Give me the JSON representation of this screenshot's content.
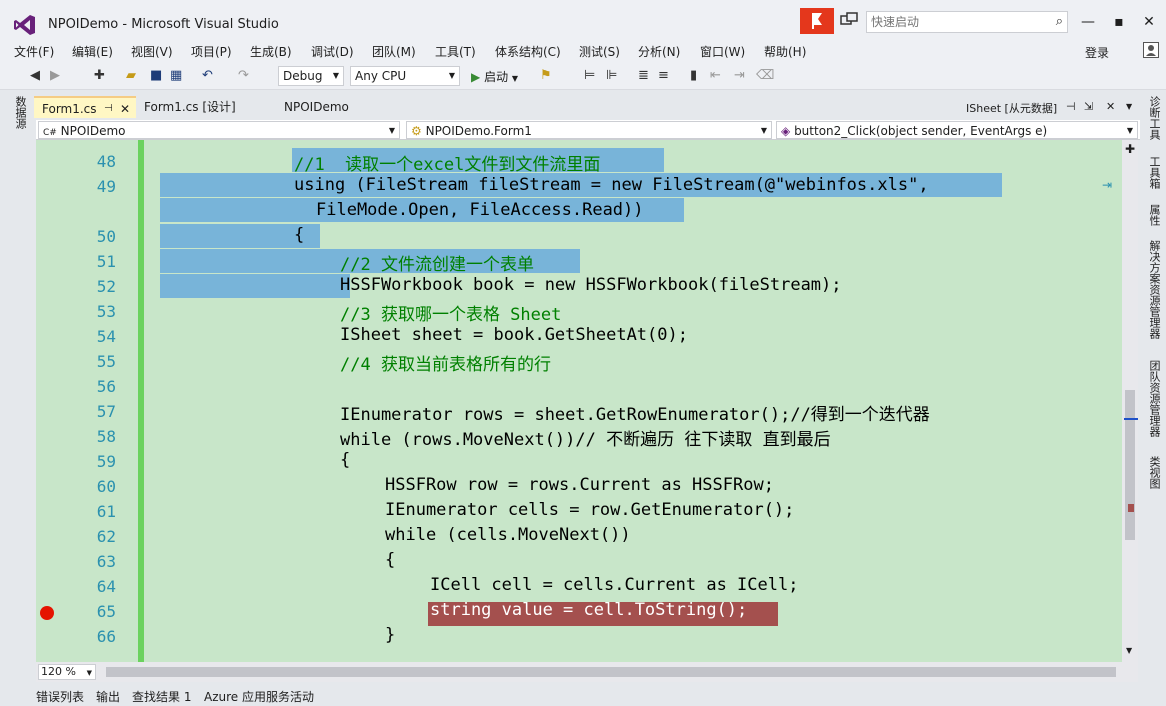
{
  "window": {
    "title": "NPOIDemo - Microsoft Visual Studio",
    "quick_launch_placeholder": "快速启动",
    "login": "登录"
  },
  "menu": [
    "文件(F)",
    "编辑(E)",
    "视图(V)",
    "项目(P)",
    "生成(B)",
    "调试(D)",
    "团队(M)",
    "工具(T)",
    "体系结构(C)",
    "测试(S)",
    "分析(N)",
    "窗口(W)",
    "帮助(H)"
  ],
  "toolbar": {
    "config": "Debug",
    "platform": "Any CPU",
    "start": "启动"
  },
  "left_tabs": [
    "数据源"
  ],
  "right_tabs": [
    "诊断工具",
    "工具箱",
    "属性",
    "解决方案资源管理器",
    "团队资源管理器",
    "类视图"
  ],
  "doc_tabs": [
    {
      "label": "Form1.cs",
      "active": true
    },
    {
      "label": "Form1.cs [设计]",
      "active": false
    },
    {
      "label": "NPOIDemo",
      "active": false
    }
  ],
  "doc_right": "ISheet [从元数据]",
  "nav": {
    "project": "NPOIDemo",
    "type": "NPOIDemo.Form1",
    "member": "button2_Click(object sender, EventArgs e)"
  },
  "editor": {
    "zoom": "120 %",
    "breakpoint_line": "65",
    "lines": [
      {
        "no": "48",
        "text": "//1  读取一个excel文件到文件流里面"
      },
      {
        "no": "49",
        "text": "using (FileStream fileStream = new FileStream(@\"webinfos.xls\","
      },
      {
        "no": "",
        "text": "FileMode.Open, FileAccess.Read))"
      },
      {
        "no": "50",
        "text": "{"
      },
      {
        "no": "51",
        "text": "//2 文件流创建一个表单"
      },
      {
        "no": "52",
        "text": "HSSFWorkbook book = new HSSFWorkbook(fileStream);"
      },
      {
        "no": "53",
        "text": "//3 获取哪一个表格 Sheet"
      },
      {
        "no": "54",
        "text": "ISheet sheet = book.GetSheetAt(0);"
      },
      {
        "no": "55",
        "text": "//4 获取当前表格所有的行"
      },
      {
        "no": "56",
        "text": ""
      },
      {
        "no": "57",
        "text": "IEnumerator rows = sheet.GetRowEnumerator();//得到一个迭代器"
      },
      {
        "no": "58",
        "text": "while (rows.MoveNext())// 不断遍历 往下读取 直到最后"
      },
      {
        "no": "59",
        "text": "{"
      },
      {
        "no": "60",
        "text": "HSSFRow row = rows.Current as HSSFRow;"
      },
      {
        "no": "61",
        "text": "IEnumerator cells = row.GetEnumerator();"
      },
      {
        "no": "62",
        "text": "while (cells.MoveNext())"
      },
      {
        "no": "63",
        "text": "{"
      },
      {
        "no": "64",
        "text": "ICell cell = cells.Current as ICell;"
      },
      {
        "no": "65",
        "text": "string value = cell.ToString();"
      },
      {
        "no": "66",
        "text": "}"
      }
    ]
  },
  "bottom_tabs": [
    "错误列表",
    "输出",
    "查找结果 1",
    "Azure 应用服务活动"
  ],
  "colors": {
    "editor_bg": "#c8e6c9",
    "selection": "#78b4d9",
    "breakpoint": "#e51400",
    "keyword": "#0000ff",
    "type": "#2b91af",
    "comment": "#008000",
    "string": "#a31515"
  }
}
